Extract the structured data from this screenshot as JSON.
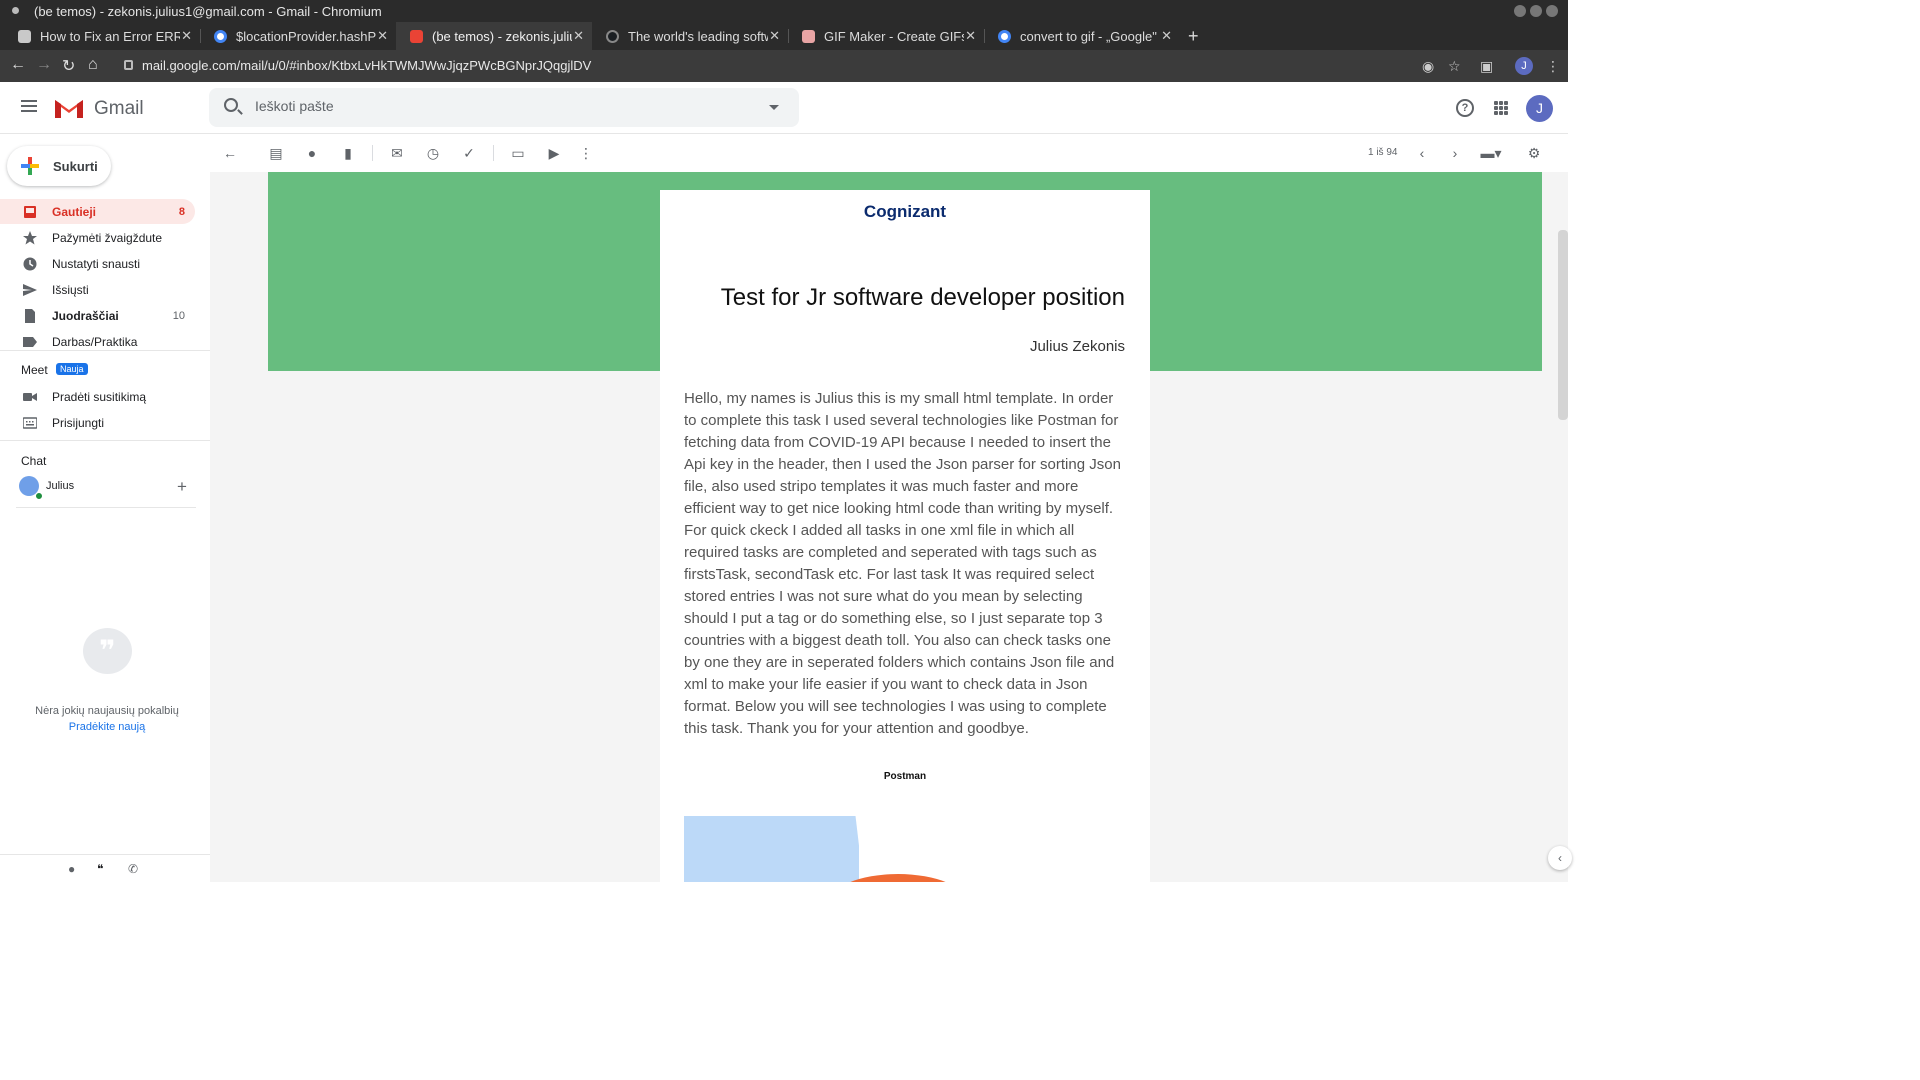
{
  "window": {
    "title": "(be temos) - zekonis.julius1@gmail.com - Gmail - Chromium"
  },
  "tabs": [
    {
      "label": "How to Fix an Error ERR_",
      "color": "#c9c9c9"
    },
    {
      "label": "$locationProvider.hashP",
      "color": "#4285f4"
    },
    {
      "label": "(be temos) - zekonis.julius",
      "color": "#ea4335"
    },
    {
      "label": "The world's leading softw",
      "color": "#1b1f23"
    },
    {
      "label": "GIF Maker - Create GIFs fro",
      "color": "#e8a4a4"
    },
    {
      "label": "convert to gif - „Google\" p",
      "color": "#4285f4"
    }
  ],
  "tab_close": "✕",
  "newtab": "+",
  "address": {
    "url": "mail.google.com/mail/u/0/#inbox/KtbxLvHkTWMJWwJjqzPWcBGNprJQqgjlDV"
  },
  "profile_initial": "J",
  "gmail": {
    "logo_word": "Gmail",
    "search_placeholder": "Ieškoti pašte",
    "avatar_initial": "J",
    "help_glyph": "?"
  },
  "compose": {
    "label": "Sukurti"
  },
  "nav": [
    {
      "label": "Gautieji",
      "count": "8",
      "icon": "inbox-icon"
    },
    {
      "label": "Pažymėti žvaigždute",
      "count": "",
      "icon": "star-icon"
    },
    {
      "label": "Nustatyti snausti",
      "count": "",
      "icon": "clock-icon"
    },
    {
      "label": "Išsiųsti",
      "count": "",
      "icon": "send-icon"
    },
    {
      "label": "Juodraščiai",
      "count": "10",
      "icon": "draft-icon"
    },
    {
      "label": "Darbas/Praktika",
      "count": "",
      "icon": "label-icon"
    }
  ],
  "meet": {
    "title": "Meet",
    "badge": "Nauja",
    "items": [
      {
        "label": "Pradėti susitikimą",
        "icon": "video-icon"
      },
      {
        "label": "Prisijungti",
        "icon": "keyboard-icon"
      }
    ]
  },
  "chat": {
    "title": "Chat",
    "user": "Julius",
    "add": "+",
    "bubble_glyph": "❞",
    "empty": "Nėra jokių naujausių pokalbių",
    "start": "Pradėkite naują"
  },
  "actions": {
    "pager": "1 iš 94"
  },
  "message": {
    "brand": "Cognizant",
    "title": "Test for Jr software developer position",
    "author": "Julius Zekonis",
    "body": "Hello, my names is Julius this is my small html template. In order to complete this task I used several technologies like Postman for fetching data from COVID-19 API because I needed to insert the Api key in the header, then I used the Json parser for sorting Json file, also used stripo templates it was much faster and more efficient way to get nice looking html code than writing by myself. For quick ckeck I added all tasks in one xml file in which all required tasks are completed and seperated with tags such as firstsTask, secondTask etc. For last task It was required select stored entries I was not sure what do you mean by selecting should I put a tag or do something else, so I just separate top 3 countries with a biggest death toll. You also can check tasks one by one they are in seperated folders which contains Json file and xml to make your life easier if you want to check data in Json format. Below you will see technologies I was using to complete this task. Thank you for your attention and goodbye.",
    "tech_title": "Postman"
  },
  "colors": {
    "band": "#67bd7f",
    "accent_red": "#d93025",
    "brand_navy": "#0b2b6e"
  }
}
